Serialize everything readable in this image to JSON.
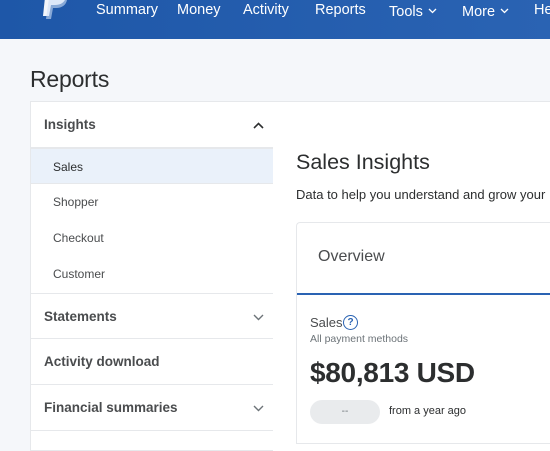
{
  "nav": {
    "logo_icon": "paypal-logo-icon",
    "items": [
      {
        "label": "Summary"
      },
      {
        "label": "Money"
      },
      {
        "label": "Activity"
      },
      {
        "label": "Reports"
      },
      {
        "label": "Tools"
      },
      {
        "label": "More"
      },
      {
        "label": "He"
      }
    ],
    "bar_color": "#2a63b3"
  },
  "page": {
    "title": "Reports"
  },
  "sidebar": {
    "sections": [
      {
        "label": "Insights",
        "icon": "chevron-up-icon",
        "expanded": true
      },
      {
        "label": "Statements",
        "icon": "chevron-down-icon"
      },
      {
        "label": "Activity download"
      },
      {
        "label": "Financial summaries",
        "icon": "chevron-down-icon"
      }
    ],
    "insights_items": [
      {
        "label": "Sales",
        "active": true
      },
      {
        "label": "Shopper"
      },
      {
        "label": "Checkout"
      },
      {
        "label": "Customer"
      }
    ]
  },
  "main": {
    "title": "Sales Insights",
    "description": "Data to help you understand and grow your",
    "card": {
      "tab_label": "Overview",
      "sales_label": "Sales",
      "help_icon": "question-icon",
      "help_glyph": "?",
      "payment_methods": "All payment methods",
      "amount": "$80,813 USD",
      "change_value": "--",
      "change_note": "from a year ago"
    },
    "accent_color": "#2a63b3"
  }
}
